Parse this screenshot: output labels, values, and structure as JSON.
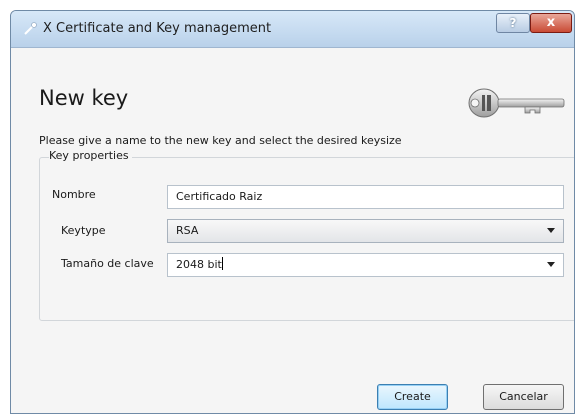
{
  "window": {
    "title": "X Certificate and Key management",
    "help_label": "?",
    "close_label": "x"
  },
  "page": {
    "title": "New key",
    "description": "Please give a name to the new key and select the desired keysize"
  },
  "key_properties": {
    "group_label": "Key properties",
    "name_label": "Nombre",
    "name_value": "Certificado Raiz",
    "keytype_label": "Keytype",
    "keytype_value": "RSA",
    "keysize_label": "Tamaño de clave",
    "keysize_value": "2048 bit"
  },
  "buttons": {
    "create_label": "Create",
    "cancel_label": "Cancelar"
  },
  "icons": {
    "app": "key-icon",
    "illustration": "key-illustration-icon",
    "dropdown": "chevron-down-icon"
  },
  "colors": {
    "titlebar": "#b9d1ea",
    "close_button": "#c94b35",
    "default_button": "#bee6fd"
  }
}
